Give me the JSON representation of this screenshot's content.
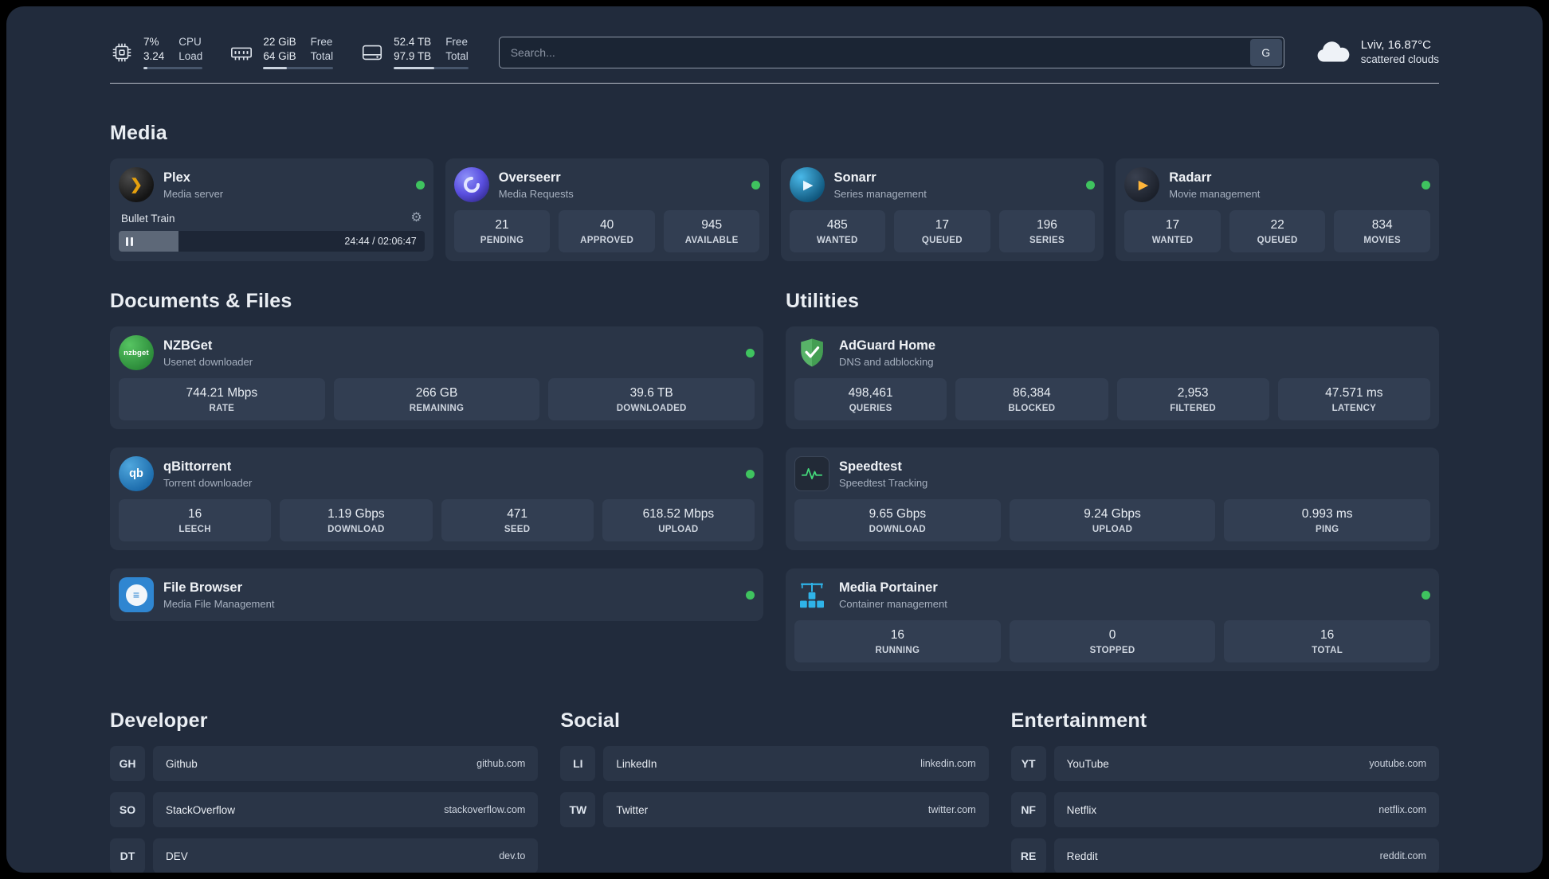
{
  "theme": {
    "panel": "#212b3c",
    "card": "#2a3547",
    "stat_box": "#323e52",
    "accent_green": "#3fc35f",
    "plex_orange": "#e5a00d",
    "radarr_yellow": "#ffb53a",
    "filebrowser_blue": "#2f86d1"
  },
  "icons": {
    "plex_glyph": "❯",
    "sonarr_glyph": "▶",
    "radarr_glyph": "▶",
    "nzbget_text": "nzbget",
    "qbittorrent_text": "qb",
    "filebrowser_glyph": "≡",
    "gear_glyph": "⚙"
  },
  "topbar": {
    "cpu": {
      "line1": "7%",
      "line2": "3.24",
      "label1": "CPU",
      "label2": "Load",
      "bar_percent": 7
    },
    "ram": {
      "line1": "22 GiB",
      "line2": "64 GiB",
      "label1": "Free",
      "label2": "Total",
      "bar_percent": 34
    },
    "disk": {
      "line1": "52.4 TB",
      "line2": "97.9 TB",
      "label1": "Free",
      "label2": "Total",
      "bar_percent": 54
    },
    "search": {
      "placeholder": "Search...",
      "engine_label": "G"
    },
    "weather": {
      "location": "Lviv, 16.87°C",
      "condition": "scattered clouds"
    }
  },
  "media": {
    "title": "Media",
    "plex": {
      "name": "Plex",
      "subtitle": "Media server",
      "now_playing": "Bullet Train",
      "time": "24:44 / 02:06:47",
      "progress_percent": 19.5
    },
    "overseerr": {
      "name": "Overseerr",
      "subtitle": "Media Requests",
      "stats": [
        {
          "value": "21",
          "label": "PENDING"
        },
        {
          "value": "40",
          "label": "APPROVED"
        },
        {
          "value": "945",
          "label": "AVAILABLE"
        }
      ]
    },
    "sonarr": {
      "name": "Sonarr",
      "subtitle": "Series management",
      "stats": [
        {
          "value": "485",
          "label": "WANTED"
        },
        {
          "value": "17",
          "label": "QUEUED"
        },
        {
          "value": "196",
          "label": "SERIES"
        }
      ]
    },
    "radarr": {
      "name": "Radarr",
      "subtitle": "Movie management",
      "stats": [
        {
          "value": "17",
          "label": "WANTED"
        },
        {
          "value": "22",
          "label": "QUEUED"
        },
        {
          "value": "834",
          "label": "MOVIES"
        }
      ]
    }
  },
  "documents": {
    "title": "Documents & Files",
    "nzbget": {
      "name": "NZBGet",
      "subtitle": "Usenet downloader",
      "stats": [
        {
          "value": "744.21 Mbps",
          "label": "RATE"
        },
        {
          "value": "266 GB",
          "label": "REMAINING"
        },
        {
          "value": "39.6 TB",
          "label": "DOWNLOADED"
        }
      ]
    },
    "qbittorrent": {
      "name": "qBittorrent",
      "subtitle": "Torrent downloader",
      "stats": [
        {
          "value": "16",
          "label": "LEECH"
        },
        {
          "value": "1.19 Gbps",
          "label": "DOWNLOAD"
        },
        {
          "value": "471",
          "label": "SEED"
        },
        {
          "value": "618.52 Mbps",
          "label": "UPLOAD"
        }
      ]
    },
    "filebrowser": {
      "name": "File Browser",
      "subtitle": "Media File Management"
    }
  },
  "utilities": {
    "title": "Utilities",
    "adguard": {
      "name": "AdGuard Home",
      "subtitle": "DNS and adblocking",
      "stats": [
        {
          "value": "498,461",
          "label": "QUERIES"
        },
        {
          "value": "86,384",
          "label": "BLOCKED"
        },
        {
          "value": "2,953",
          "label": "FILTERED"
        },
        {
          "value": "47.571 ms",
          "label": "LATENCY"
        }
      ]
    },
    "speedtest": {
      "name": "Speedtest",
      "subtitle": "Speedtest Tracking",
      "stats": [
        {
          "value": "9.65 Gbps",
          "label": "DOWNLOAD"
        },
        {
          "value": "9.24 Gbps",
          "label": "UPLOAD"
        },
        {
          "value": "0.993 ms",
          "label": "PING"
        }
      ]
    },
    "portainer": {
      "name": "Media Portainer",
      "subtitle": "Container management",
      "stats": [
        {
          "value": "16",
          "label": "RUNNING"
        },
        {
          "value": "0",
          "label": "STOPPED"
        },
        {
          "value": "16",
          "label": "TOTAL"
        }
      ]
    }
  },
  "bookmarks": {
    "developer": {
      "title": "Developer",
      "links": [
        {
          "abbr": "GH",
          "name": "Github",
          "url": "github.com"
        },
        {
          "abbr": "SO",
          "name": "StackOverflow",
          "url": "stackoverflow.com"
        },
        {
          "abbr": "DT",
          "name": "DEV",
          "url": "dev.to"
        }
      ]
    },
    "social": {
      "title": "Social",
      "links": [
        {
          "abbr": "LI",
          "name": "LinkedIn",
          "url": "linkedin.com"
        },
        {
          "abbr": "TW",
          "name": "Twitter",
          "url": "twitter.com"
        }
      ]
    },
    "entertainment": {
      "title": "Entertainment",
      "links": [
        {
          "abbr": "YT",
          "name": "YouTube",
          "url": "youtube.com"
        },
        {
          "abbr": "NF",
          "name": "Netflix",
          "url": "netflix.com"
        },
        {
          "abbr": "RE",
          "name": "Reddit",
          "url": "reddit.com"
        }
      ]
    }
  }
}
